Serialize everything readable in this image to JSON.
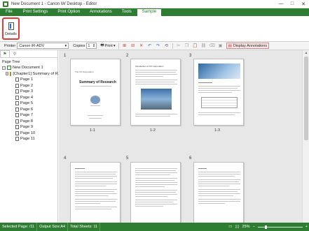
{
  "window": {
    "title": "New Document 1 - Canon iW Desktop - Editor",
    "minimize": "—",
    "maximize": "□",
    "close": "✕"
  },
  "ribbon": {
    "tabs": [
      "File",
      "Print Settings",
      "Print Option",
      "Annotations",
      "Tools",
      "Sample"
    ],
    "active_tab": "Sample",
    "details_label": "Details"
  },
  "toolbar": {
    "printer_label": "Printer",
    "printer_value": "Canon iR-ADV",
    "copies_label": "Copies",
    "copies_value": "1",
    "print_label": "Print",
    "display_annotations_label": "Display Annotations"
  },
  "left_panel": {
    "page_tree_label": "Page Tree",
    "document": "New Document 1",
    "chapter": "[Chapter1] Summary of R",
    "pages": [
      "Page 1",
      "Page 2",
      "Page 3",
      "Page 4",
      "Page 5",
      "Page 6",
      "Page 7",
      "Page 8",
      "Page 9",
      "Page 10",
      "Page 11"
    ]
  },
  "thumbnails": [
    {
      "number": "1",
      "caption": "1-1",
      "title": "Summary of Research",
      "org": "The XX Corporation"
    },
    {
      "number": "2",
      "caption": "1-2",
      "heading": "Introduction of XX Corporation"
    },
    {
      "number": "3",
      "caption": "1-3"
    },
    {
      "number": "4"
    },
    {
      "number": "5"
    },
    {
      "number": "6"
    }
  ],
  "statusbar": {
    "selected_page": "Selected Page: /11",
    "output_size": "Output Size:A4",
    "total_sheets": "Total Sheets: 11",
    "zoom": "25%",
    "zoom_minus": "−",
    "zoom_plus": "+"
  }
}
